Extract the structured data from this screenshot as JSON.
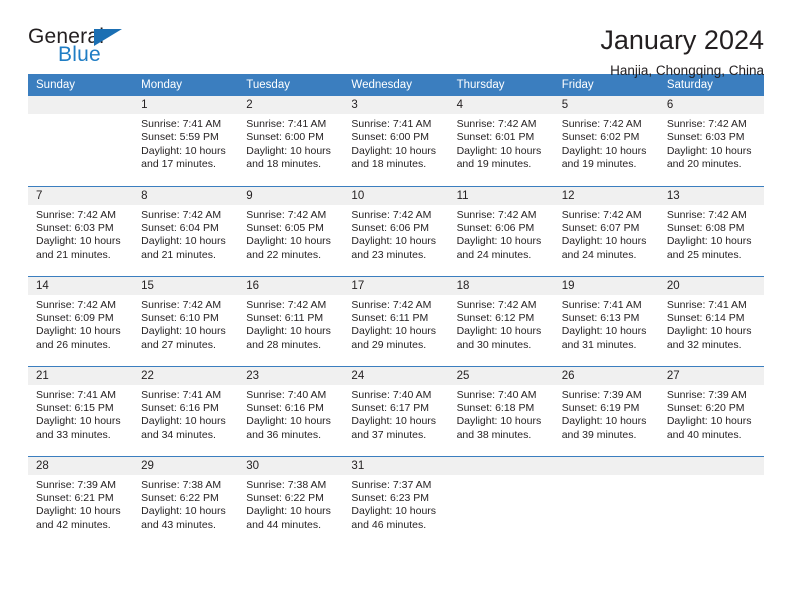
{
  "brand": {
    "name_top": "General",
    "name_bottom": "Blue",
    "accent_color": "#1f7dc4",
    "triangle_icon": "triangle-icon"
  },
  "header": {
    "title": "January 2024",
    "subtitle": "Hanjia, Chongqing, China",
    "header_bg": "#3b7ebf",
    "header_text": "#ffffff"
  },
  "calendar": {
    "weekday_headers": [
      "Sunday",
      "Monday",
      "Tuesday",
      "Wednesday",
      "Thursday",
      "Friday",
      "Saturday"
    ],
    "weeks": [
      [
        {
          "day": "",
          "blank": true,
          "sunrise": "",
          "sunset": "",
          "daylight1": "",
          "daylight2": ""
        },
        {
          "day": "1",
          "sunrise": "Sunrise: 7:41 AM",
          "sunset": "Sunset: 5:59 PM",
          "daylight1": "Daylight: 10 hours",
          "daylight2": "and 17 minutes."
        },
        {
          "day": "2",
          "sunrise": "Sunrise: 7:41 AM",
          "sunset": "Sunset: 6:00 PM",
          "daylight1": "Daylight: 10 hours",
          "daylight2": "and 18 minutes."
        },
        {
          "day": "3",
          "sunrise": "Sunrise: 7:41 AM",
          "sunset": "Sunset: 6:00 PM",
          "daylight1": "Daylight: 10 hours",
          "daylight2": "and 18 minutes."
        },
        {
          "day": "4",
          "sunrise": "Sunrise: 7:42 AM",
          "sunset": "Sunset: 6:01 PM",
          "daylight1": "Daylight: 10 hours",
          "daylight2": "and 19 minutes."
        },
        {
          "day": "5",
          "sunrise": "Sunrise: 7:42 AM",
          "sunset": "Sunset: 6:02 PM",
          "daylight1": "Daylight: 10 hours",
          "daylight2": "and 19 minutes."
        },
        {
          "day": "6",
          "sunrise": "Sunrise: 7:42 AM",
          "sunset": "Sunset: 6:03 PM",
          "daylight1": "Daylight: 10 hours",
          "daylight2": "and 20 minutes."
        }
      ],
      [
        {
          "day": "7",
          "sunrise": "Sunrise: 7:42 AM",
          "sunset": "Sunset: 6:03 PM",
          "daylight1": "Daylight: 10 hours",
          "daylight2": "and 21 minutes."
        },
        {
          "day": "8",
          "sunrise": "Sunrise: 7:42 AM",
          "sunset": "Sunset: 6:04 PM",
          "daylight1": "Daylight: 10 hours",
          "daylight2": "and 21 minutes."
        },
        {
          "day": "9",
          "sunrise": "Sunrise: 7:42 AM",
          "sunset": "Sunset: 6:05 PM",
          "daylight1": "Daylight: 10 hours",
          "daylight2": "and 22 minutes."
        },
        {
          "day": "10",
          "sunrise": "Sunrise: 7:42 AM",
          "sunset": "Sunset: 6:06 PM",
          "daylight1": "Daylight: 10 hours",
          "daylight2": "and 23 minutes."
        },
        {
          "day": "11",
          "sunrise": "Sunrise: 7:42 AM",
          "sunset": "Sunset: 6:06 PM",
          "daylight1": "Daylight: 10 hours",
          "daylight2": "and 24 minutes."
        },
        {
          "day": "12",
          "sunrise": "Sunrise: 7:42 AM",
          "sunset": "Sunset: 6:07 PM",
          "daylight1": "Daylight: 10 hours",
          "daylight2": "and 24 minutes."
        },
        {
          "day": "13",
          "sunrise": "Sunrise: 7:42 AM",
          "sunset": "Sunset: 6:08 PM",
          "daylight1": "Daylight: 10 hours",
          "daylight2": "and 25 minutes."
        }
      ],
      [
        {
          "day": "14",
          "sunrise": "Sunrise: 7:42 AM",
          "sunset": "Sunset: 6:09 PM",
          "daylight1": "Daylight: 10 hours",
          "daylight2": "and 26 minutes."
        },
        {
          "day": "15",
          "sunrise": "Sunrise: 7:42 AM",
          "sunset": "Sunset: 6:10 PM",
          "daylight1": "Daylight: 10 hours",
          "daylight2": "and 27 minutes."
        },
        {
          "day": "16",
          "sunrise": "Sunrise: 7:42 AM",
          "sunset": "Sunset: 6:11 PM",
          "daylight1": "Daylight: 10 hours",
          "daylight2": "and 28 minutes."
        },
        {
          "day": "17",
          "sunrise": "Sunrise: 7:42 AM",
          "sunset": "Sunset: 6:11 PM",
          "daylight1": "Daylight: 10 hours",
          "daylight2": "and 29 minutes."
        },
        {
          "day": "18",
          "sunrise": "Sunrise: 7:42 AM",
          "sunset": "Sunset: 6:12 PM",
          "daylight1": "Daylight: 10 hours",
          "daylight2": "and 30 minutes."
        },
        {
          "day": "19",
          "sunrise": "Sunrise: 7:41 AM",
          "sunset": "Sunset: 6:13 PM",
          "daylight1": "Daylight: 10 hours",
          "daylight2": "and 31 minutes."
        },
        {
          "day": "20",
          "sunrise": "Sunrise: 7:41 AM",
          "sunset": "Sunset: 6:14 PM",
          "daylight1": "Daylight: 10 hours",
          "daylight2": "and 32 minutes."
        }
      ],
      [
        {
          "day": "21",
          "sunrise": "Sunrise: 7:41 AM",
          "sunset": "Sunset: 6:15 PM",
          "daylight1": "Daylight: 10 hours",
          "daylight2": "and 33 minutes."
        },
        {
          "day": "22",
          "sunrise": "Sunrise: 7:41 AM",
          "sunset": "Sunset: 6:16 PM",
          "daylight1": "Daylight: 10 hours",
          "daylight2": "and 34 minutes."
        },
        {
          "day": "23",
          "sunrise": "Sunrise: 7:40 AM",
          "sunset": "Sunset: 6:16 PM",
          "daylight1": "Daylight: 10 hours",
          "daylight2": "and 36 minutes."
        },
        {
          "day": "24",
          "sunrise": "Sunrise: 7:40 AM",
          "sunset": "Sunset: 6:17 PM",
          "daylight1": "Daylight: 10 hours",
          "daylight2": "and 37 minutes."
        },
        {
          "day": "25",
          "sunrise": "Sunrise: 7:40 AM",
          "sunset": "Sunset: 6:18 PM",
          "daylight1": "Daylight: 10 hours",
          "daylight2": "and 38 minutes."
        },
        {
          "day": "26",
          "sunrise": "Sunrise: 7:39 AM",
          "sunset": "Sunset: 6:19 PM",
          "daylight1": "Daylight: 10 hours",
          "daylight2": "and 39 minutes."
        },
        {
          "day": "27",
          "sunrise": "Sunrise: 7:39 AM",
          "sunset": "Sunset: 6:20 PM",
          "daylight1": "Daylight: 10 hours",
          "daylight2": "and 40 minutes."
        }
      ],
      [
        {
          "day": "28",
          "sunrise": "Sunrise: 7:39 AM",
          "sunset": "Sunset: 6:21 PM",
          "daylight1": "Daylight: 10 hours",
          "daylight2": "and 42 minutes."
        },
        {
          "day": "29",
          "sunrise": "Sunrise: 7:38 AM",
          "sunset": "Sunset: 6:22 PM",
          "daylight1": "Daylight: 10 hours",
          "daylight2": "and 43 minutes."
        },
        {
          "day": "30",
          "sunrise": "Sunrise: 7:38 AM",
          "sunset": "Sunset: 6:22 PM",
          "daylight1": "Daylight: 10 hours",
          "daylight2": "and 44 minutes."
        },
        {
          "day": "31",
          "sunrise": "Sunrise: 7:37 AM",
          "sunset": "Sunset: 6:23 PM",
          "daylight1": "Daylight: 10 hours",
          "daylight2": "and 46 minutes."
        },
        {
          "day": "",
          "blank": true,
          "sunrise": "",
          "sunset": "",
          "daylight1": "",
          "daylight2": ""
        },
        {
          "day": "",
          "blank": true,
          "sunrise": "",
          "sunset": "",
          "daylight1": "",
          "daylight2": ""
        },
        {
          "day": "",
          "blank": true,
          "sunrise": "",
          "sunset": "",
          "daylight1": "",
          "daylight2": ""
        }
      ]
    ]
  }
}
